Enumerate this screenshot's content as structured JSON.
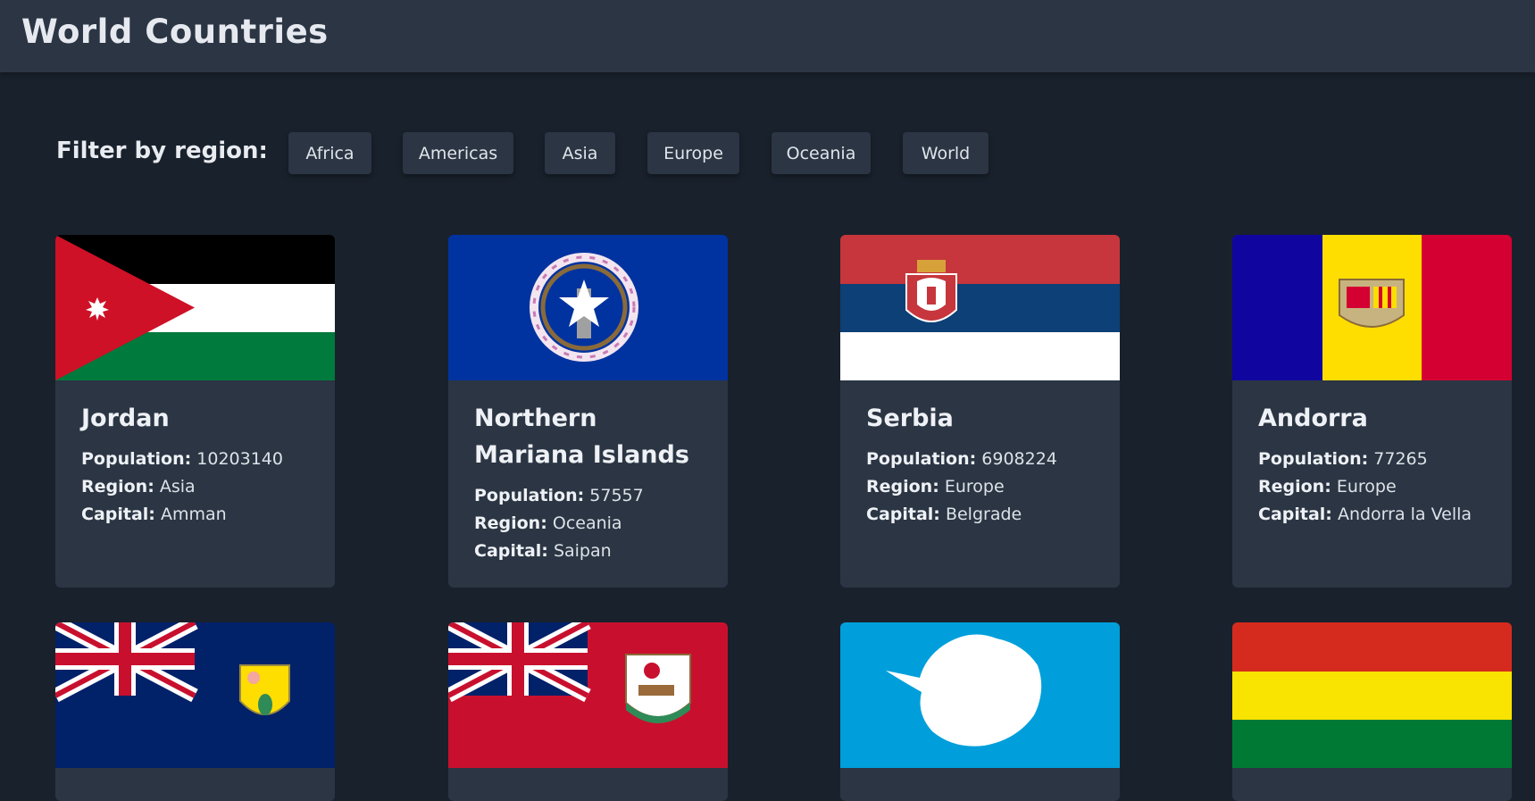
{
  "header": {
    "title": "World Countries"
  },
  "filter": {
    "label": "Filter by region:",
    "buttons": [
      "Africa",
      "Americas",
      "Asia",
      "Europe",
      "Oceania",
      "World"
    ]
  },
  "labels": {
    "population": "Population:",
    "region": "Region:",
    "capital": "Capital:"
  },
  "countries": [
    {
      "name": "Jordan",
      "population": "10203140",
      "region": "Asia",
      "capital": "Amman"
    },
    {
      "name": "Northern Mariana Islands",
      "population": "57557",
      "region": "Oceania",
      "capital": "Saipan"
    },
    {
      "name": "Serbia",
      "population": "6908224",
      "region": "Europe",
      "capital": "Belgrade"
    },
    {
      "name": "Andorra",
      "population": "77265",
      "region": "Europe",
      "capital": "Andorra la Vella"
    }
  ],
  "colors": {
    "background": "#19212c",
    "card": "#2b3543",
    "text": "#f0f2f5"
  }
}
